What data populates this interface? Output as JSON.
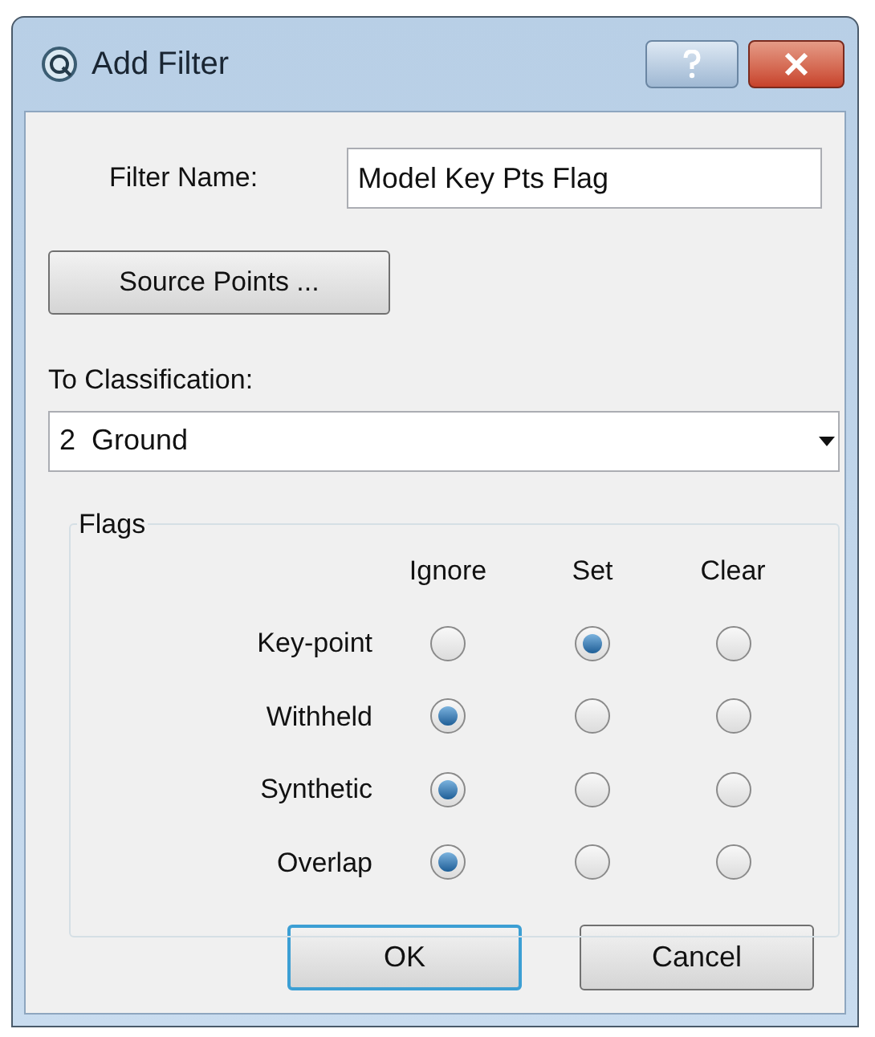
{
  "window": {
    "title": "Add Filter"
  },
  "filter_name": {
    "label": "Filter Name:",
    "value": "Model Key Pts Flag"
  },
  "source_points_button": "Source Points ...",
  "classification": {
    "label": "To Classification:",
    "value": "2  Ground"
  },
  "flags": {
    "title": "Flags",
    "columns": [
      "Ignore",
      "Set",
      "Clear"
    ],
    "rows": [
      {
        "label": "Key-point",
        "options": [
          {
            "selected": false
          },
          {
            "selected": true
          },
          {
            "selected": false
          }
        ]
      },
      {
        "label": "Withheld",
        "options": [
          {
            "selected": true
          },
          {
            "selected": false
          },
          {
            "selected": false
          }
        ]
      },
      {
        "label": "Synthetic",
        "options": [
          {
            "selected": true
          },
          {
            "selected": false
          },
          {
            "selected": false
          }
        ]
      },
      {
        "label": "Overlap",
        "options": [
          {
            "selected": true
          },
          {
            "selected": false
          },
          {
            "selected": false
          }
        ]
      }
    ]
  },
  "buttons": [
    {
      "label": "OK",
      "kind": "default"
    },
    {
      "label": "Cancel",
      "kind": "normal"
    }
  ]
}
